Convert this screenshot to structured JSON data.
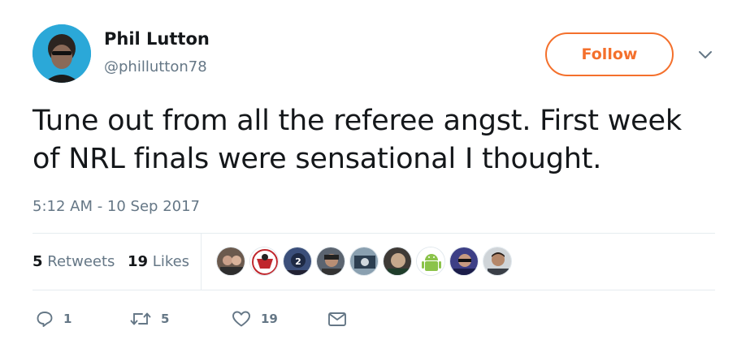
{
  "user": {
    "name": "Phil Lutton",
    "handle": "@phillutton78"
  },
  "follow_button": {
    "label": "Follow"
  },
  "tweet": {
    "text_line1": "Tune out from all the referee angst. First week",
    "text_line2": "of NRL finals were sensational I thought.",
    "timestamp": "5:12 AM - 10 Sep 2017"
  },
  "stats": {
    "retweets_count": "5",
    "retweets_label": "Retweets",
    "likes_count": "19",
    "likes_label": "Likes"
  },
  "liked_by_avatars": [
    "avatar",
    "avatar",
    "avatar",
    "avatar",
    "avatar",
    "avatar",
    "android-avatar",
    "avatar",
    "avatar"
  ],
  "actions": {
    "reply_count": "1",
    "retweet_count": "5",
    "like_count": "19"
  },
  "colors": {
    "accent": "#f4702c",
    "secondary_text": "#657786",
    "primary_text": "#14171a",
    "divider": "#e6ecf0"
  }
}
